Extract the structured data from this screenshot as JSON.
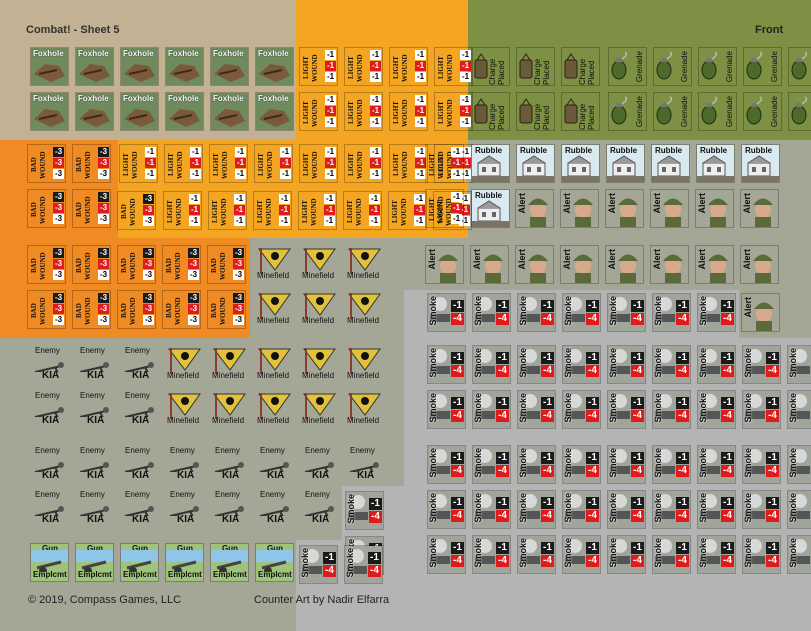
{
  "sheet": {
    "title": "Combat! - Sheet 5",
    "side": "Front",
    "copyright": "© 2019, Compass Games, LLC",
    "art_credit": "Counter Art by Nadir Elfarra"
  },
  "colors": {
    "tan": "#c2b293",
    "olive": "#7e9043",
    "orange_light": "#f4a623",
    "orange_dark": "#f08a22",
    "sage": "#a4a796",
    "gray_light": "#b4b4b4",
    "gray_mid": "#a8a8a8"
  },
  "counters": {
    "foxhole": {
      "label": "Foxhole",
      "icon": "foxhole-icon"
    },
    "light_wound": {
      "label": "LIGHT WOUND",
      "mods": [
        "-1",
        "-1",
        "-1"
      ],
      "icon": "wound-modifier-icon"
    },
    "bad_wound": {
      "label": "BAD WOUND",
      "mods": [
        "-3",
        "-3",
        "-3"
      ],
      "icon": "wound-modifier-icon"
    },
    "charge_placed": {
      "label": "Charge Placed",
      "icon": "satchel-charge-icon"
    },
    "grenade": {
      "label": "Grenade",
      "icon": "grenade-icon"
    },
    "rubble": {
      "label": "Rubble",
      "icon": "ruined-building-icon"
    },
    "alert": {
      "label": "Alert",
      "icon": "soldier-portrait-icon"
    },
    "minefield": {
      "label": "Minefield",
      "icon": "skull-mine-sign-icon"
    },
    "smoke": {
      "label": "Smoke",
      "mods": [
        "-1",
        "-4"
      ],
      "icon": "smoke-tank-icon"
    },
    "enemy_kia": {
      "label_top": "Enemy",
      "label_bottom": "KIA",
      "icon": "fallen-soldier-icon"
    },
    "gun_emplcmt": {
      "label_top": "Gun",
      "label_bottom": "Emplcmt",
      "icon": "artillery-gun-icon"
    }
  }
}
